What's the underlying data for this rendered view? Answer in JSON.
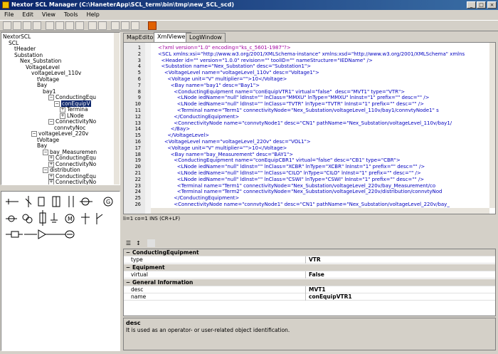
{
  "window": {
    "title": "Nextor SCL Manager (C:\\HaneterApp\\SCL_term\\bin\\tmp\\new_SCL_scd)"
  },
  "menu": [
    {
      "label": "File"
    },
    {
      "label": "Edit"
    },
    {
      "label": "View"
    },
    {
      "label": "Tools"
    },
    {
      "label": "Help"
    }
  ],
  "tree": [
    {
      "label": "NextorSCL",
      "box": ""
    },
    {
      "label": "SCL",
      "box": ""
    },
    {
      "label": "tHeader",
      "box": ""
    },
    {
      "label": "Substation",
      "box": ""
    },
    {
      "label": "Nex_Substation",
      "box": ""
    },
    {
      "label": "VoltageLevel",
      "box": ""
    },
    {
      "label": "voltageLevel_110v",
      "box": ""
    },
    {
      "label": "tVoltage",
      "box": ""
    },
    {
      "label": "Bay",
      "box": ""
    },
    {
      "label": "bay1",
      "box": ""
    },
    {
      "label": "ConductingEqu",
      "box": "−"
    },
    {
      "label": "conEquipV",
      "box": "−",
      "selected": true
    },
    {
      "label": "Termina",
      "box": "+"
    },
    {
      "label": "LNode",
      "box": "+"
    },
    {
      "label": "ConnectivityNo",
      "box": "−"
    },
    {
      "label": "connvtyNoc",
      "box": ""
    },
    {
      "label": "voltageLevel_220v",
      "box": "−"
    },
    {
      "label": "tVoltage",
      "box": ""
    },
    {
      "label": "Bay",
      "box": ""
    },
    {
      "label": "bay_Measuremen",
      "box": "−"
    },
    {
      "label": "ConductingEqu",
      "box": "+"
    },
    {
      "label": "ConnectivityNo",
      "box": "+"
    },
    {
      "label": "distribution",
      "box": "−"
    },
    {
      "label": "ConductingEqu",
      "box": "+"
    },
    {
      "label": "ConnectivityNo",
      "box": "+"
    }
  ],
  "tabs": [
    {
      "label": "MapEditor"
    },
    {
      "label": "XmlViewer"
    },
    {
      "label": "LogWindow"
    }
  ],
  "xml_lines": [
    {
      "n": "1",
      "text": "<?xml version=\"1.0\" encoding=\"ks_c_5601-1987\"?>"
    },
    {
      "n": "2",
      "text": "<SCL xmlns:xsi=\"http://www.w3.org/2001/XMLSchema-instance\" xmlns:xsd=\"http://www.w3.org/2001/XMLSchema\" xmlns"
    },
    {
      "n": "3",
      "text": "  <Header id=\"\" version=\"1.0.0\" revision=\"\" toolID=\"\" nameStructure=\"IEDName\" />"
    },
    {
      "n": "4",
      "text": "  <Substation name=\"Nex_Substation\" desc=\"Substation1\">"
    },
    {
      "n": "5",
      "text": "    <VoltageLevel name=\"voltageLevel_110v\" desc=\"Voltage1\">"
    },
    {
      "n": "6",
      "text": "      <Voltage unit=\"V\" multiplier=\"\">10</Voltage>"
    },
    {
      "n": "7",
      "text": "        <Bay name=\"bay1\" desc=\"Bay1\">"
    },
    {
      "n": "8",
      "text": "          <ConductingEquipment name=\"conEquipVTR1\" virtual=\"false\"  desc=\"MVT1\" type=\"VTR\">"
    },
    {
      "n": "9",
      "text": "            <LNode iedName=\"null\" ldInst=\"\" lnClass=\"MMXU\" lnType=\"MMXU\" lnInst=\"1\" prefix=\"\" desc=\"\" />"
    },
    {
      "n": "10",
      "text": "            <LNode iedName=\"null\" ldInst=\"\" lnClass=\"TVTR\" lnType=\"TVTR\" lnInst=\"1\" prefix=\"\" desc=\"\" />"
    },
    {
      "n": "11",
      "text": "            <Terminal name=\"Term1\" connectivityNode=\"Nex_Substation/voltageLevel_110v/bay1/connvtyNode1\" s"
    },
    {
      "n": "12",
      "text": "          </ConductingEquipment>"
    },
    {
      "n": "13",
      "text": "          <ConnectivityNode name=\"connvtyNode1\" desc=\"CN1\" pathName=\"Nex_Substation/voltageLevel_110v/bay1/"
    },
    {
      "n": "14",
      "text": "        </Bay>"
    },
    {
      "n": "15",
      "text": "      </VoltageLevel>"
    },
    {
      "n": "16",
      "text": "    <VoltageLevel name=\"voltageLevel_220v\" desc=\"VOL1\">"
    },
    {
      "n": "17",
      "text": "      <Voltage unit=\"V\" multiplier=\"\">10</Voltage>"
    },
    {
      "n": "18",
      "text": "        <Bay name=\"bay_Measurement\" desc=\"BAY1\">"
    },
    {
      "n": "19",
      "text": "          <ConductingEquipment name=\"conEquipCBR1\" virtual=\"false\" desc=\"CB1\" type=\"CBR\">"
    },
    {
      "n": "20",
      "text": "            <LNode iedName=\"null\" ldInst=\"\" lnClass=\"XCBR\" lnType=\"XCBR\" lnInst=\"1\" prefix=\"\" desc=\"\" />"
    },
    {
      "n": "21",
      "text": "            <LNode iedName=\"null\" ldInst=\"\" lnClass=\"CILO\" lnType=\"CILO\" lnInst=\"1\" prefix=\"\" desc=\"\" />"
    },
    {
      "n": "22",
      "text": "            <LNode iedName=\"null\" ldInst=\"\" lnClass=\"CSWI\" lnType=\"CSWI\" lnInst=\"1\" prefix=\"\" desc=\"\" />"
    },
    {
      "n": "23",
      "text": "            <Terminal name=\"Term1\" connectivityNode=\"Nex_Substation/voltageLevel_220v/bay_Measurement/co"
    },
    {
      "n": "24",
      "text": "            <Terminal name=\"Term2\" connectivityNode=\"Nex_Substation/voltageLevel_220v/distribution/connvtyNod"
    },
    {
      "n": "25",
      "text": "          </ConductingEquipment>"
    },
    {
      "n": "26",
      "text": "          <ConnectivityNode name=\"connvtyNode1\" desc=\"CN1\" pathName=\"Nex_Substation/voltageLevel_220v/bay_"
    }
  ],
  "editor_status": "li=1 co=1 INS (CR+LF)",
  "properties": [
    {
      "kind": "cat",
      "label": "ConductingEquipment"
    },
    {
      "kind": "prop",
      "name": "type",
      "value": "VTR"
    },
    {
      "kind": "cat",
      "label": "Equipment"
    },
    {
      "kind": "prop",
      "name": "virtual",
      "value": "False"
    },
    {
      "kind": "cat",
      "label": "General Information"
    },
    {
      "kind": "prop",
      "name": "desc",
      "value": "MVT1"
    },
    {
      "kind": "prop",
      "name": "name",
      "value": "conEquipVTR1"
    }
  ],
  "description": {
    "title": "desc",
    "text": "It is used as an operator- or user-related object identification."
  },
  "colors": {
    "accent": "#0a246a",
    "tag": "#0000c0",
    "attr": "#c00000",
    "value": "#0000ff"
  }
}
